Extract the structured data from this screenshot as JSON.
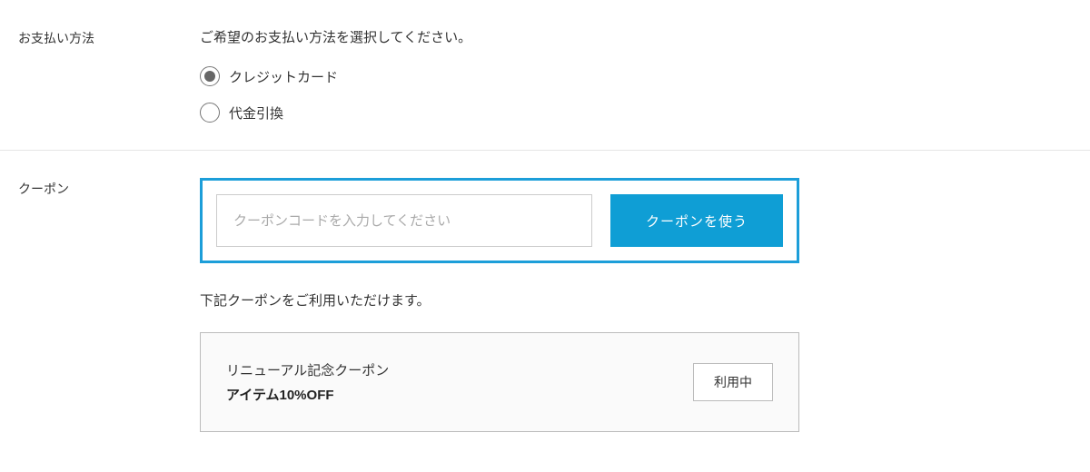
{
  "payment": {
    "section_label": "お支払い方法",
    "instruction": "ご希望のお支払い方法を選択してください。",
    "options": {
      "credit_card": "クレジットカード",
      "cash_on_delivery": "代金引換"
    }
  },
  "coupon": {
    "section_label": "クーポン",
    "input_placeholder": "クーポンコードを入力してください",
    "apply_button": "クーポンを使う",
    "available_text": "下記クーポンをご利用いただけます。",
    "card": {
      "title": "リニューアル記念クーポン",
      "discount": "アイテム10%OFF",
      "status": "利用中"
    }
  }
}
